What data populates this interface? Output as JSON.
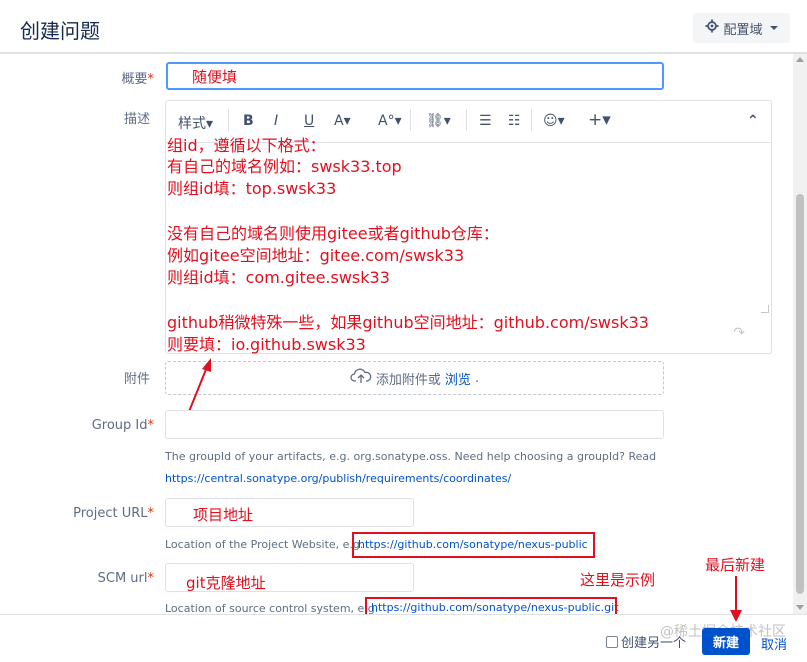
{
  "header": {
    "title": "创建问题",
    "config_label": "配置域"
  },
  "form": {
    "summary_label": "概要",
    "summary_value": "随便填",
    "description_label": "描述",
    "toolbar": {
      "style": "样式",
      "bold": "B",
      "italic": "I",
      "underline": "U",
      "text_color": "A",
      "more_format": "A°",
      "link": "⛓",
      "bullet_list": "☰",
      "numbered_list": "☷",
      "emoji": "☺",
      "insert": "+",
      "collapse": "⌃"
    },
    "attachment_label": "附件",
    "attachment_text": "添加附件或",
    "attachment_browse": "浏览",
    "group_id_label": "Group Id",
    "group_id_help": "The groupId of your artifacts, e.g. org.sonatype.oss. Need help choosing a groupId? Read",
    "group_id_help_link": "https://central.sonatype.org/publish/requirements/coordinates/",
    "project_url_label": "Project URL",
    "project_url_value": "项目地址",
    "project_url_help": "Location of the Project Website, e.g.",
    "project_url_example": "https://github.com/sonatype/nexus-public",
    "scm_url_label": "SCM url",
    "scm_url_value": "git克隆地址",
    "scm_url_help": "Location of source control system, e.g.",
    "scm_url_example": "https://github.com/sonatype/nexus-public.git"
  },
  "annotation": {
    "lines": [
      "组id，遵循以下格式：",
      "有自己的域名例如：swsk33.top",
      "则组id填：top.swsk33",
      "",
      "没有自己的域名则使用gitee或者github仓库：",
      "例如gitee空间地址：gitee.com/swsk33",
      "则组id填：com.gitee.swsk33",
      "",
      "github稍微特殊一些，如果github空间地址：github.com/swsk33",
      "则要填：io.github.swsk33"
    ],
    "example_note": "这里是示例",
    "final_note": "最后新建"
  },
  "footer": {
    "create_another": "创建另一个",
    "create_button": "新建",
    "cancel": "取消",
    "watermark": "@稀土掘金技术社区"
  },
  "colors": {
    "primary": "#0052cc",
    "focus_border": "#4c9aff",
    "annotation_red": "#e0101f"
  }
}
